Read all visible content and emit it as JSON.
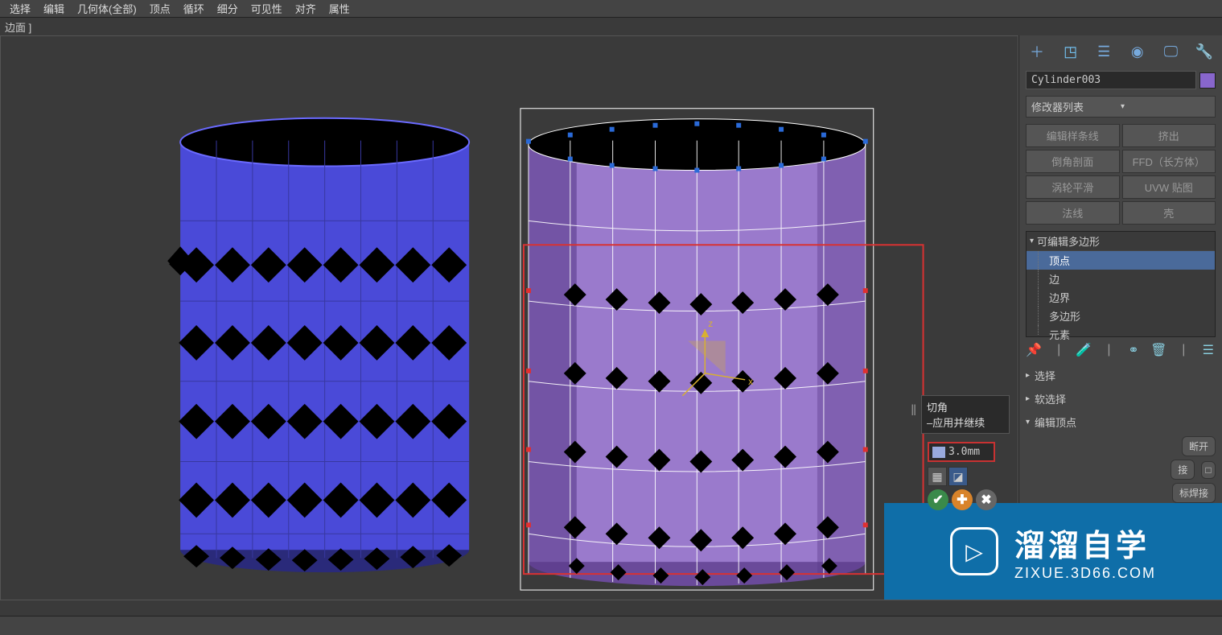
{
  "menu": {
    "items": [
      "选择",
      "编辑",
      "几何体(全部)",
      "顶点",
      "循环",
      "细分",
      "可见性",
      "对齐",
      "属性"
    ]
  },
  "context_label": "边面 ]",
  "object_name": "Cylinder003",
  "dropdown_label": "修改器列表",
  "mod_buttons": [
    "编辑样条线",
    "挤出",
    "倒角剖面",
    "FFD（长方体）",
    "涡轮平滑",
    "UVW 贴图",
    "法线",
    "壳"
  ],
  "stack_head": "可编辑多边形",
  "sub_items": [
    "顶点",
    "边",
    "边界",
    "多边形",
    "元素"
  ],
  "caddy": {
    "title": "切角",
    "subtitle": "–应用并继续",
    "value": "3.0mm"
  },
  "rollouts": {
    "select": "选择",
    "soft": "软选择",
    "edit_vert": "编辑顶点",
    "break": "断开",
    "weld1": "接",
    "weld2": "标焊接"
  },
  "watermark": {
    "line1": "溜溜自学",
    "line2": "ZIXUE.3D66.COM"
  }
}
